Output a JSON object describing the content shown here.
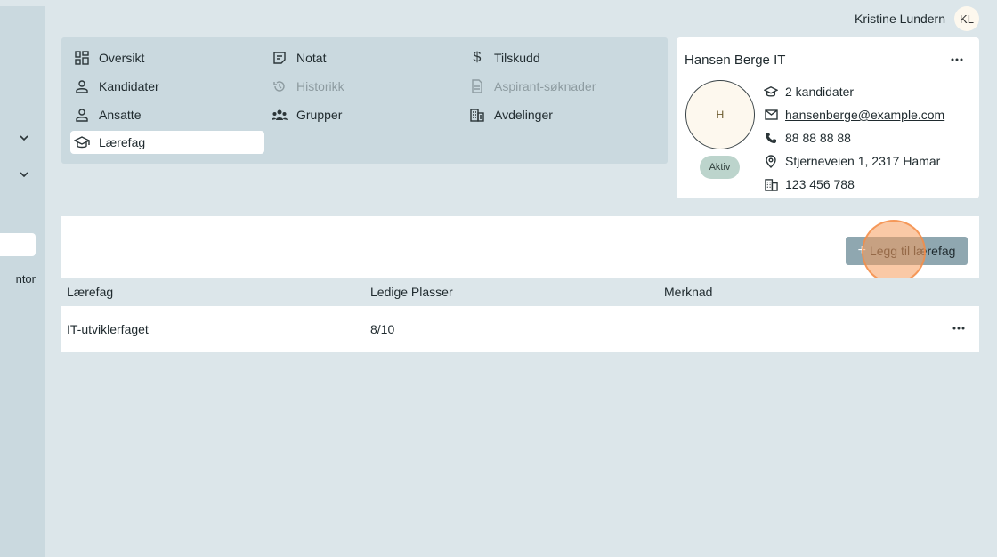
{
  "header": {
    "user_name": "Kristine Lundern",
    "user_initials": "KL"
  },
  "sidebar": {
    "truncated_item": "ntor"
  },
  "nav": {
    "items": [
      {
        "label": "Oversikt",
        "icon": "dashboard-icon"
      },
      {
        "label": "Notat",
        "icon": "note-icon"
      },
      {
        "label": "Tilskudd",
        "icon": "dollar-icon"
      },
      {
        "label": "Kandidater",
        "icon": "person-icon"
      },
      {
        "label": "Historikk",
        "icon": "history-icon"
      },
      {
        "label": "Aspirant-søknader",
        "icon": "document-icon"
      },
      {
        "label": "Ansatte",
        "icon": "person-icon"
      },
      {
        "label": "Grupper",
        "icon": "group-icon"
      },
      {
        "label": "Avdelinger",
        "icon": "building-icon"
      },
      {
        "label": "Lærefag",
        "icon": "school-icon"
      }
    ],
    "active": "Lærefag"
  },
  "company": {
    "name": "Hansen Berge IT",
    "initial": "H",
    "status": "Aktiv",
    "candidates": "2 kandidater",
    "email": "hansenberge@example.com",
    "phone": "88 88 88 88",
    "address": "Stjerneveien 1, 2317 Hamar",
    "org_number": "123 456 788"
  },
  "toolbar": {
    "add_label": "Legg til lærefag",
    "add_icon": "+"
  },
  "table": {
    "headers": [
      "Lærefag",
      "Ledige Plasser",
      "Merknad"
    ],
    "rows": [
      {
        "laerefag": "IT-utviklerfaget",
        "plasser": "8/10",
        "merknad": ""
      }
    ]
  },
  "colors": {
    "background": "#dce6ea",
    "panel": "#cad9df",
    "button": "#8fa7b0",
    "status_badge": "#bcd4cc",
    "click_highlight": "#f69d5c"
  }
}
